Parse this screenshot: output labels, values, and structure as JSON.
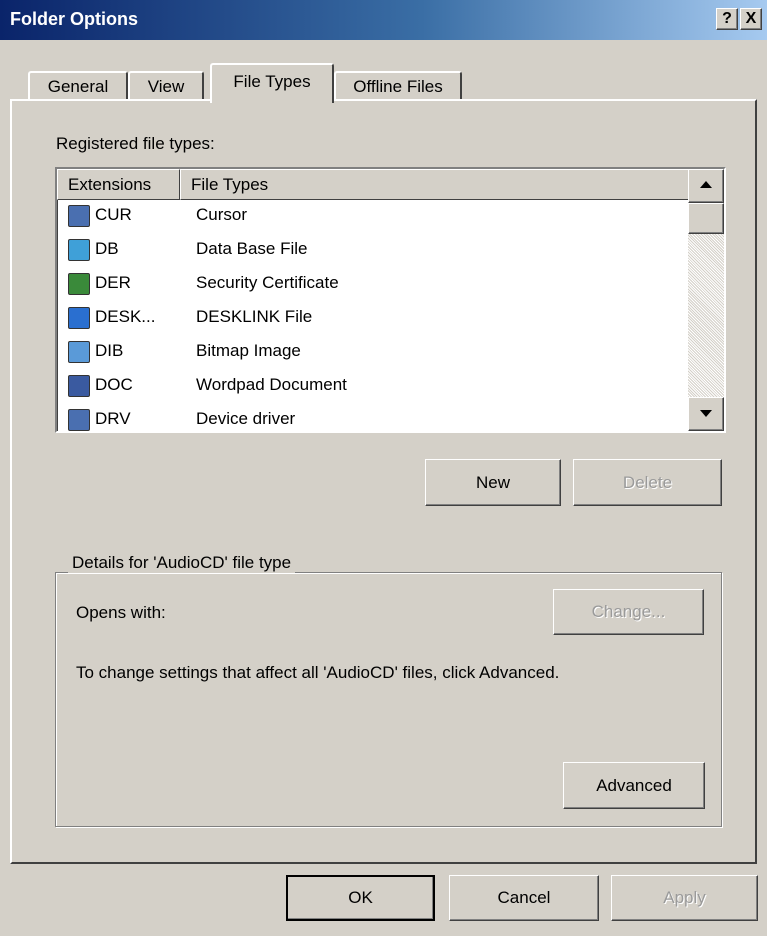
{
  "window": {
    "title": "Folder Options",
    "help_button": "?",
    "close_button": "X"
  },
  "tabs": [
    {
      "label": "General"
    },
    {
      "label": "View"
    },
    {
      "label": "File Types"
    },
    {
      "label": "Offline Files"
    }
  ],
  "registered_label": "Registered file types:",
  "list": {
    "columns": [
      "Extensions",
      "File Types"
    ],
    "rows": [
      {
        "extension": "CUR",
        "file_type": "Cursor",
        "icon": "cursor-file-icon",
        "icon_color": "#4a6fb0"
      },
      {
        "extension": "DB",
        "file_type": "Data Base File",
        "icon": "database-file-icon",
        "icon_color": "#3fa0d8"
      },
      {
        "extension": "DER",
        "file_type": "Security Certificate",
        "icon": "certificate-icon",
        "icon_color": "#3a8a3a"
      },
      {
        "extension": "DESK...",
        "file_type": "DESKLINK File",
        "icon": "desklink-file-icon",
        "icon_color": "#2a6fd0"
      },
      {
        "extension": "DIB",
        "file_type": "Bitmap Image",
        "icon": "bitmap-image-icon",
        "icon_color": "#5a9ad8"
      },
      {
        "extension": "DOC",
        "file_type": "Wordpad Document",
        "icon": "wordpad-document-icon",
        "icon_color": "#3a5aa0"
      },
      {
        "extension": "DRV",
        "file_type": "Device driver",
        "icon": "device-driver-icon",
        "icon_color": "#4a6fb0"
      }
    ]
  },
  "buttons": {
    "new": "New",
    "delete": "Delete",
    "change": "Change...",
    "advanced": "Advanced",
    "ok": "OK",
    "cancel": "Cancel",
    "apply": "Apply"
  },
  "details": {
    "legend": "Details for 'AudioCD' file type",
    "opens_with": "Opens with:",
    "info": "To change settings that affect all 'AudioCD' files, click Advanced."
  }
}
